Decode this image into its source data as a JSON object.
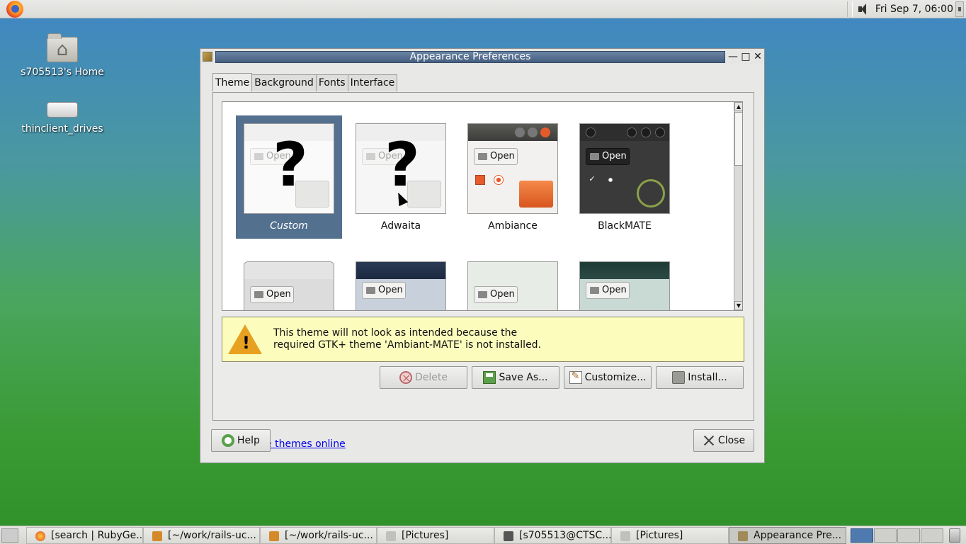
{
  "top_panel": {
    "firefox_icon": "firefox-icon",
    "clock": "Fri Sep  7, 06:00",
    "volume_icon": "volume-icon"
  },
  "desktop": {
    "icons": [
      {
        "label": "s705513's Home",
        "icon": "home-folder-icon"
      },
      {
        "label": "thinclient_drives",
        "icon": "drive-icon"
      }
    ]
  },
  "window": {
    "title": "Appearance Preferences",
    "tabs": [
      "Theme",
      "Background",
      "Fonts",
      "Interface"
    ],
    "active_tab": "Theme",
    "themes": [
      {
        "name": "Custom",
        "selected": true,
        "preview": "unknown"
      },
      {
        "name": "Adwaita",
        "selected": false,
        "preview": "unknown"
      },
      {
        "name": "Ambiance",
        "selected": false,
        "preview": "ambiance"
      },
      {
        "name": "BlackMATE",
        "selected": false,
        "preview": "blackmate"
      }
    ],
    "theme_previews_partial": [
      {
        "open_label": "Open"
      },
      {
        "open_label": "Open"
      },
      {
        "open_label": "Open"
      },
      {
        "open_label": "Open"
      }
    ],
    "preview_open_label": "Open",
    "question_mark": "?",
    "warning": {
      "line1": "This theme will not look as intended because the",
      "line2": "required GTK+ theme 'Ambiant-MATE' is not installed."
    },
    "buttons": {
      "delete": "Delete",
      "save_as": "Save As...",
      "customize": "Customize...",
      "install": "Install..."
    },
    "link": "Get more themes online",
    "help": "Help",
    "close": "Close"
  },
  "taskbar": {
    "tasks": [
      {
        "label": "[search | RubyGe...",
        "icon": "firefox-icon"
      },
      {
        "label": "[~/work/rails-uc...",
        "icon": "sublime-icon"
      },
      {
        "label": "[~/work/rails-uc...",
        "icon": "sublime-icon"
      },
      {
        "label": "[Pictures]",
        "icon": "folder-icon"
      },
      {
        "label": "[s705513@CTSC...",
        "icon": "terminal-icon"
      },
      {
        "label": "[Pictures]",
        "icon": "folder-icon"
      },
      {
        "label": "Appearance Pre...",
        "icon": "appearance-icon",
        "active": true
      }
    ],
    "workspaces": 4,
    "active_workspace": 1
  },
  "colors": {
    "selection": "#53708f",
    "title_bar": "#5a7394",
    "warning_bg": "#fcfcbd",
    "link": "#0000ee"
  }
}
